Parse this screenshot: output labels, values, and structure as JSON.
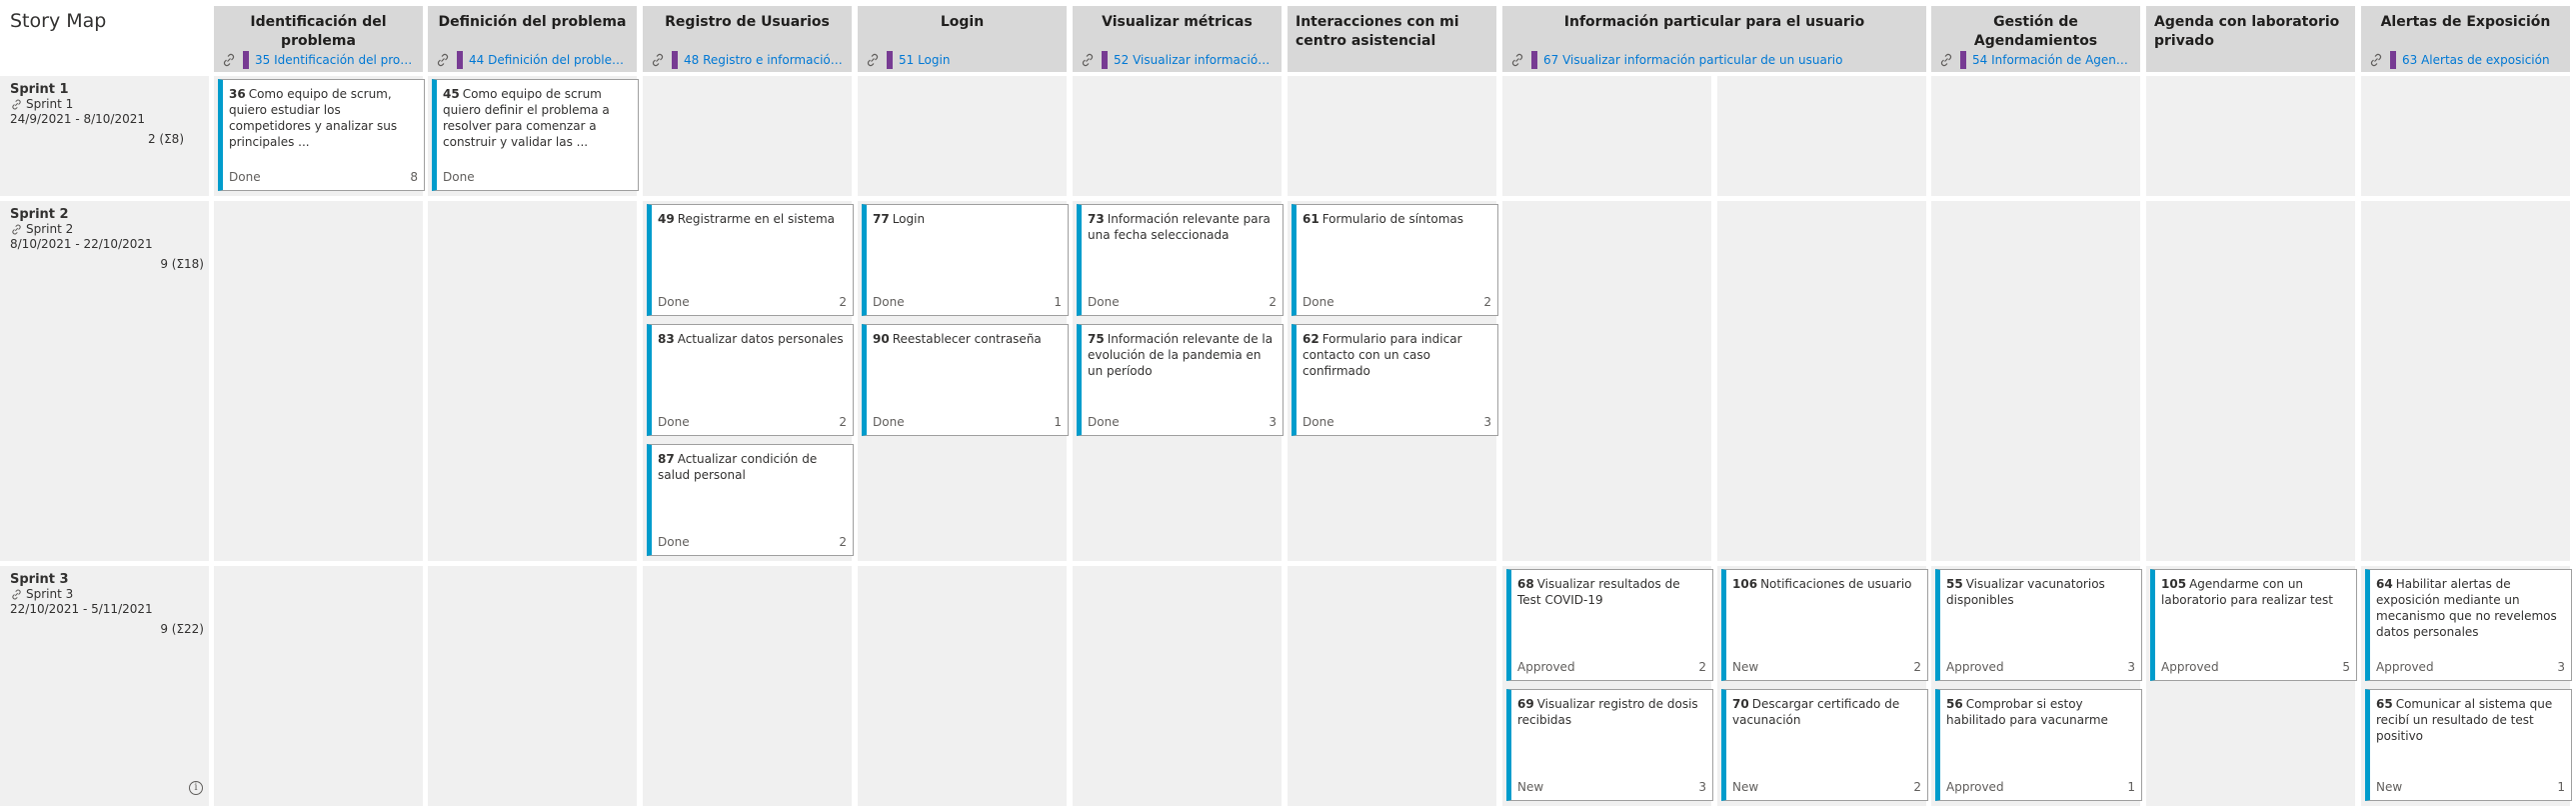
{
  "page_title": "Story Map",
  "columns": [
    {
      "title": "Identificación del problema",
      "feature": "35 Identificación del problema"
    },
    {
      "title": "Definición del problema",
      "feature": "44 Definición del problema"
    },
    {
      "title": "Registro de Usuarios",
      "feature": "48 Registro e información de ..."
    },
    {
      "title": "Login",
      "feature": "51 Login"
    },
    {
      "title": "Visualizar métricas",
      "feature": "52 Visualizar información ..."
    },
    {
      "title": "Interacciones con mi centro asistencial",
      "feature": ""
    },
    {
      "title": "Información particular para el usuario",
      "feature": "67 Visualizar información particular de un usuario"
    },
    {
      "title": "Gestión de Agendamientos",
      "feature": "54 Información de Agenda ..."
    },
    {
      "title": "Agenda con laboratorio privado",
      "feature": ""
    },
    {
      "title": "Alertas de Exposición",
      "feature": "63 Alertas de exposición"
    }
  ],
  "sprints": [
    {
      "name": "Sprint 1",
      "iteration": "Sprint 1",
      "dates": "24/9/2021 - 8/10/2021",
      "count": "2 (Σ8)"
    },
    {
      "name": "Sprint 2",
      "iteration": "Sprint 2",
      "dates": "8/10/2021 - 22/10/2021",
      "count": "9 (Σ18)"
    },
    {
      "name": "Sprint 3",
      "iteration": "Sprint 3",
      "dates": "22/10/2021 - 5/11/2021",
      "count": "9 (Σ22)"
    }
  ],
  "cards": [
    {
      "id": "36",
      "title": "Como equipo de scrum, quiero estudiar los competidores y analizar sus principales ...",
      "state": "Done",
      "effort": "8"
    },
    {
      "id": "45",
      "title": "Como equipo de scrum quiero definir el problema a resolver para comenzar a construir y validar las ...",
      "state": "Done",
      "effort": ""
    },
    {
      "id": "49",
      "title": "Registrarme en el sistema",
      "state": "Done",
      "effort": "2"
    },
    {
      "id": "83",
      "title": "Actualizar datos personales",
      "state": "Done",
      "effort": "2"
    },
    {
      "id": "87",
      "title": "Actualizar condición de salud personal",
      "state": "Done",
      "effort": "2"
    },
    {
      "id": "77",
      "title": "Login",
      "state": "Done",
      "effort": "1"
    },
    {
      "id": "90",
      "title": "Reestablecer contraseña",
      "state": "Done",
      "effort": "1"
    },
    {
      "id": "73",
      "title": "Información relevante para una fecha seleccionada",
      "state": "Done",
      "effort": "2"
    },
    {
      "id": "75",
      "title": "Información relevante de la evolución de la pandemia en un período",
      "state": "Done",
      "effort": "3"
    },
    {
      "id": "61",
      "title": "Formulario de síntomas",
      "state": "Done",
      "effort": "2"
    },
    {
      "id": "62",
      "title": "Formulario para indicar contacto con un caso confirmado",
      "state": "Done",
      "effort": "3"
    },
    {
      "id": "68",
      "title": "Visualizar resultados de Test COVID-19",
      "state": "Approved",
      "effort": "2"
    },
    {
      "id": "106",
      "title": "Notificaciones de usuario",
      "state": "New",
      "effort": "2"
    },
    {
      "id": "69",
      "title": "Visualizar registro de dosis recibidas",
      "state": "New",
      "effort": "3"
    },
    {
      "id": "70",
      "title": "Descargar certificado de vacunación",
      "state": "New",
      "effort": "2"
    },
    {
      "id": "55",
      "title": "Visualizar vacunatorios disponibles",
      "state": "Approved",
      "effort": "3"
    },
    {
      "id": "56",
      "title": "Comprobar si estoy habilitado para vacunarme",
      "state": "Approved",
      "effort": "1"
    },
    {
      "id": "105",
      "title": "Agendarme con un laboratorio para realizar test",
      "state": "Approved",
      "effort": "5"
    },
    {
      "id": "64",
      "title": "Habilitar alertas de exposición mediante un mecanismo que no revelemos datos personales",
      "state": "Approved",
      "effort": "3"
    },
    {
      "id": "65",
      "title": "Comunicar al sistema que recibí un resultado de test positivo",
      "state": "New",
      "effort": "1"
    }
  ],
  "colors": {
    "card_accent": "#009ccc",
    "feature_bar": "#773b93",
    "link": "#0078d4",
    "header_bg": "#d8d8d8",
    "cell_bg": "#f0f0f0"
  },
  "icons": {
    "link": "link-icon",
    "iteration": "iteration-icon",
    "info": "info-icon"
  },
  "info_glyph": "i"
}
